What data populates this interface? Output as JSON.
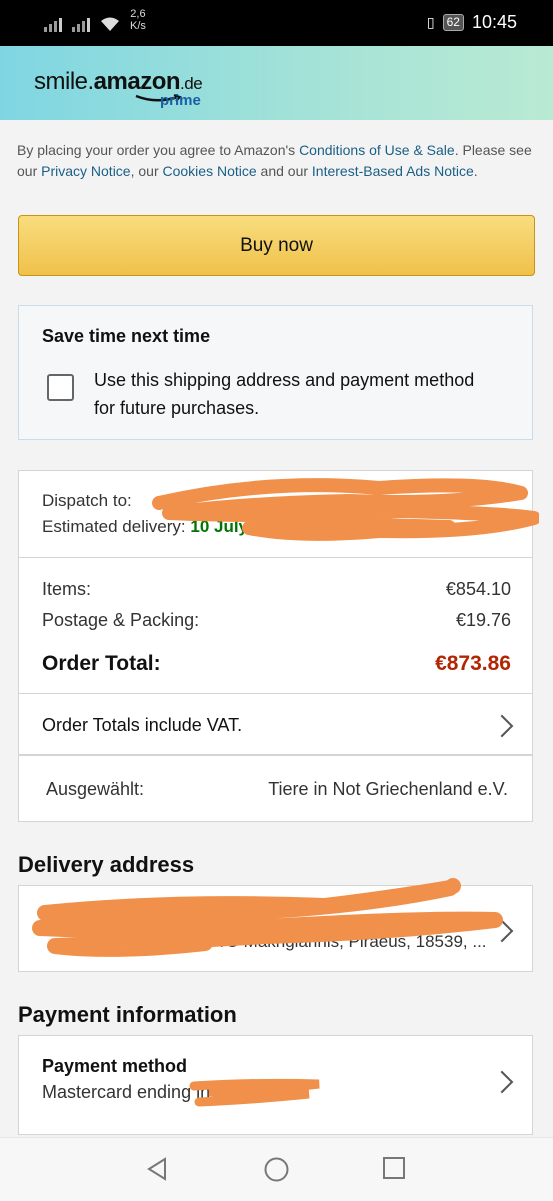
{
  "status": {
    "net_speed_value": "2,6",
    "net_speed_unit": "K/s",
    "battery": "62",
    "time": "10:45"
  },
  "header": {
    "logo_smile": "smile.",
    "logo_amazon": "amazon",
    "logo_tld": ".de",
    "logo_prime": "prime"
  },
  "legal": {
    "p1": "By placing your order you agree to Amazon's ",
    "link_conditions": "Conditions of Use & Sale",
    "p2": ". Please see our ",
    "link_privacy": "Privacy Notice",
    "p3": ", our ",
    "link_cookies": "Cookies Notice",
    "p4": " and our ",
    "link_ads": "Interest-Based Ads Notice",
    "p5": "."
  },
  "buy_now_label": "Buy now",
  "save": {
    "title": "Save time next time",
    "checkbox_text": "Use this shipping address and payment method for future purchases."
  },
  "dispatch": {
    "label": "Dispatch to:",
    "est_label": "Estimated delivery:",
    "est_value": "10 July 2020 - 13 July 2020"
  },
  "totals": {
    "items_label": "Items:",
    "items_value": "€854.10",
    "postage_label": "Postage & Packing:",
    "postage_value": "€19.76",
    "order_total_label": "Order Total:",
    "order_total_value": "€873.86"
  },
  "vat_text": "Order Totals include VAT.",
  "charity": {
    "label": "Ausgewählt:",
    "value": "Tiere in Not Griechenland e.V."
  },
  "delivery_title": "Delivery address",
  "delivery_address_visible": "/O Makrigiannis, Piraeus, 18539, ...",
  "payment_title": "Payment information",
  "payment": {
    "method_label": "Payment method",
    "method_value": "Mastercard ending in"
  },
  "colors": {
    "redaction": "#f0904a",
    "accent_link": "#1a5f86",
    "price_red": "#b12704",
    "delivery_green": "#007600"
  }
}
